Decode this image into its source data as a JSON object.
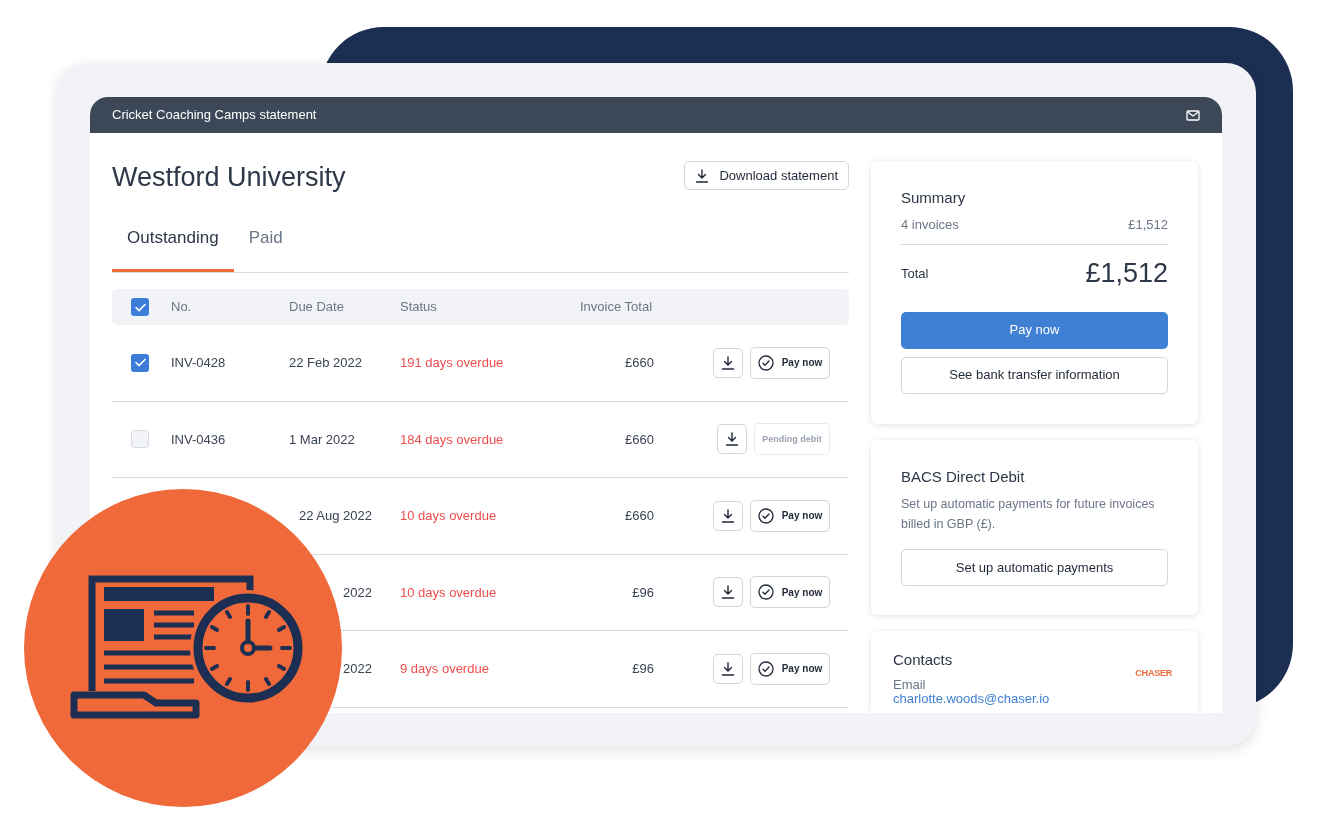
{
  "header": {
    "title": "Cricket Coaching Camps statement"
  },
  "account": {
    "name": "Westford University",
    "download_button": "Download statement"
  },
  "tabs": [
    {
      "label": "Outstanding",
      "selected": true
    },
    {
      "label": "Paid",
      "selected": false
    }
  ],
  "table": {
    "select_all_checked": true,
    "columns": [
      "No.",
      "Due Date",
      "Status",
      "Invoice Total"
    ],
    "rows": [
      {
        "checked": true,
        "no": "INV-0428",
        "due": "22 Feb 2022",
        "status": "191 days overdue",
        "total": "£660",
        "action": {
          "kind": "pay",
          "label": "Pay now"
        }
      },
      {
        "checked": false,
        "no": "INV-0436",
        "due": "1 Mar 2022",
        "status": "184 days overdue",
        "total": "£660",
        "action": {
          "kind": "pending",
          "label": "Pending debit"
        }
      },
      {
        "due": "22 Aug 2022",
        "status": "10 days overdue",
        "total": "£660",
        "action": {
          "kind": "pay",
          "label": "Pay now"
        }
      },
      {
        "due": "2022",
        "status": "10 days overdue",
        "total": "£96",
        "action": {
          "kind": "pay",
          "label": "Pay now"
        }
      },
      {
        "due": "2022",
        "status": "9 days overdue",
        "total": "£96",
        "action": {
          "kind": "pay",
          "label": "Pay now"
        }
      }
    ]
  },
  "summary": {
    "title": "Summary",
    "count": "4 invoices",
    "subtotal": "£1,512",
    "total_label": "Total",
    "total": "£1,512",
    "pay_button": "Pay now",
    "bank_button": "See bank transfer information"
  },
  "direct_debit": {
    "title": "BACS Direct Debit",
    "text": "Set up automatic payments for future invoices billed in GBP (£).",
    "button": "Set up automatic payments"
  },
  "contacts": {
    "title": "Contacts",
    "email_label": "Email",
    "email": "charlotte.woods@chaser.io",
    "logo": "CHASER"
  }
}
